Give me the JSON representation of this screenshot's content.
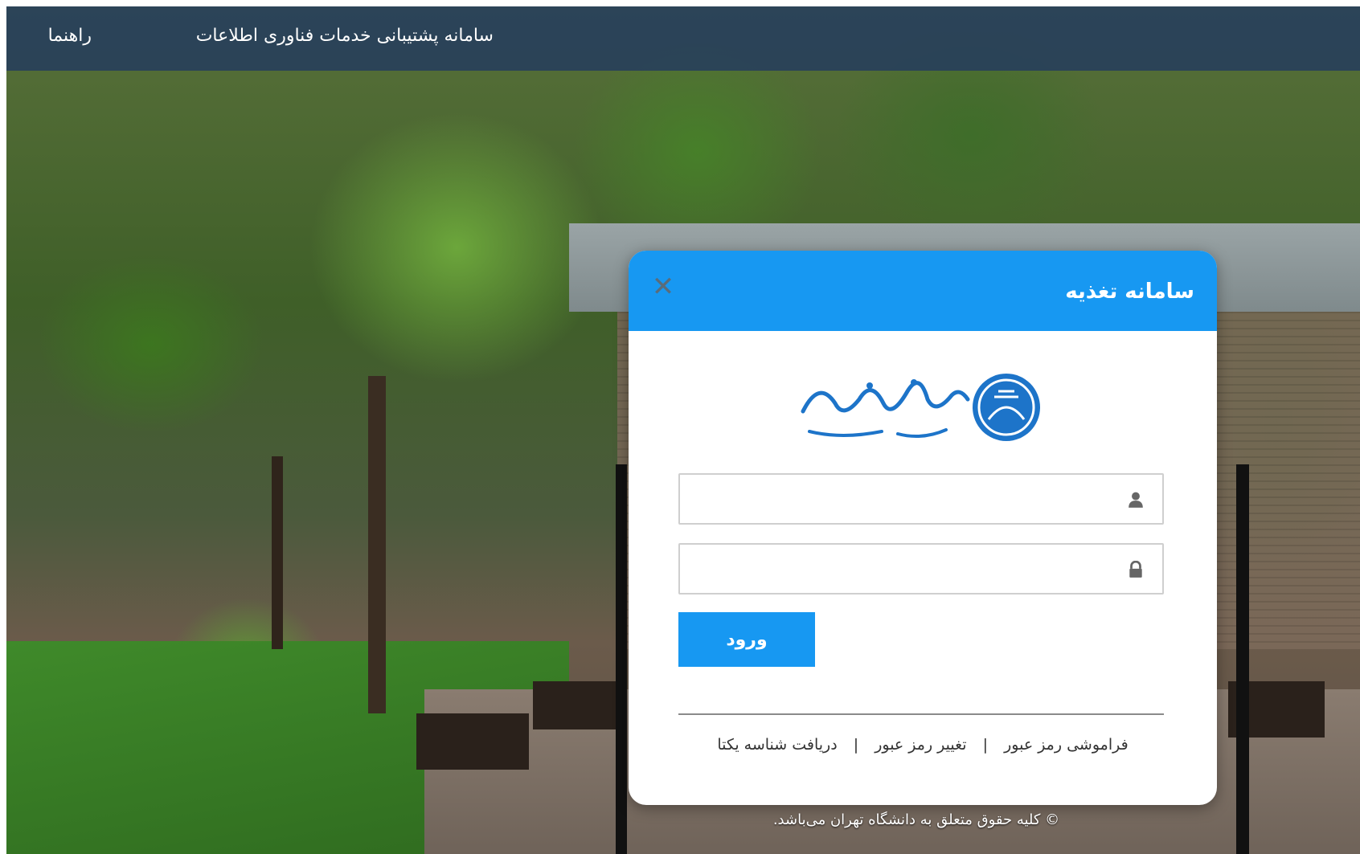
{
  "topbar": {
    "title": "سامانه پشتیبانی خدمات فناوری اطلاعات",
    "help_link": "راهنما"
  },
  "modal": {
    "title": "سامانه تغذیه",
    "close_icon": "close-icon",
    "logo_text": "دانشگاه تهران",
    "username": {
      "value": "",
      "placeholder": "",
      "icon": "user-icon"
    },
    "password": {
      "value": "",
      "placeholder": "",
      "icon": "lock-icon"
    },
    "submit_label": "ورود",
    "links": [
      "فراموشی رمز عبور",
      "تغییر رمز عبور",
      "دریافت شناسه یکتا"
    ],
    "separator": "|"
  },
  "footer": {
    "copyright": "© کلیه حقوق متعلق به دانشگاه تهران می‌باشد."
  },
  "colors": {
    "accent": "#1798f2",
    "topbar": "#263e5c"
  }
}
